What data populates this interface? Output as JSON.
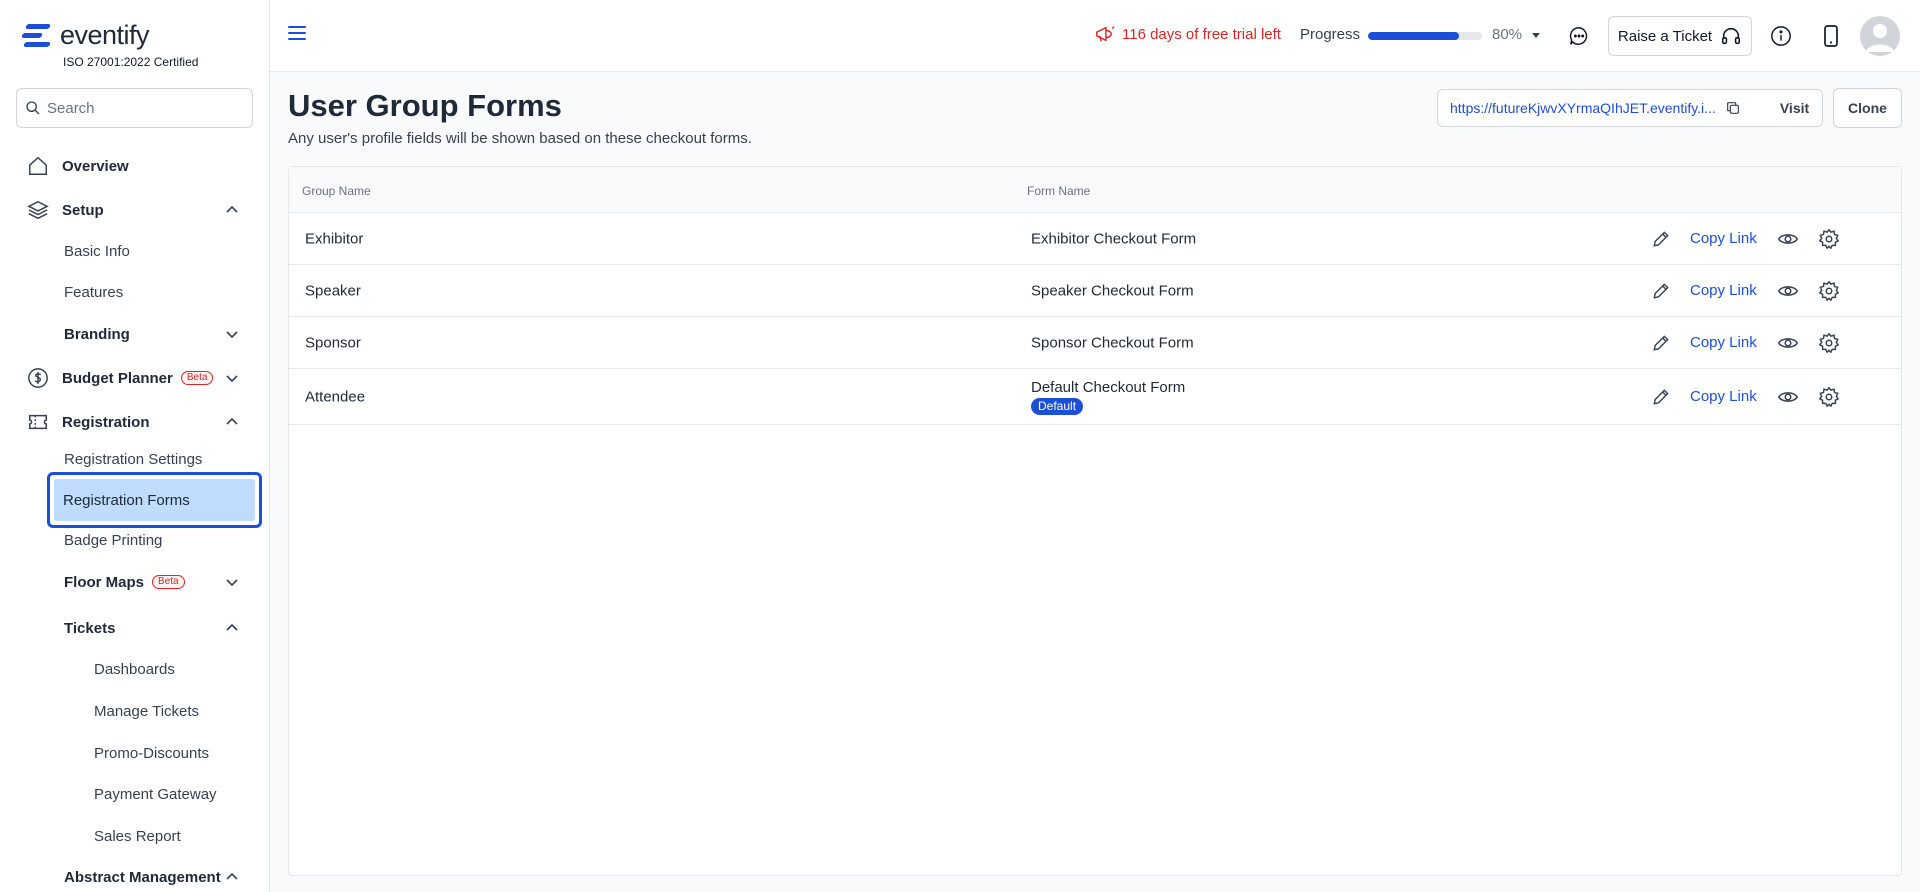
{
  "brand": {
    "name": "eventify",
    "certification": "ISO 27001:2022 Certified"
  },
  "search": {
    "placeholder": "Search",
    "value": ""
  },
  "sidebar": {
    "overview": "Overview",
    "setup": "Setup",
    "basic_info": "Basic Info",
    "features": "Features",
    "branding": "Branding",
    "budget_planner": "Budget Planner",
    "beta": "Beta",
    "registration": "Registration",
    "registration_settings": "Registration Settings",
    "registration_forms": "Registration Forms",
    "badge_printing": "Badge Printing",
    "floor_maps": "Floor Maps",
    "tickets": "Tickets",
    "dashboards": "Dashboards",
    "manage_tickets": "Manage Tickets",
    "promo_discounts": "Promo-Discounts",
    "payment_gateway": "Payment Gateway",
    "sales_report": "Sales Report",
    "abstract_management": "Abstract Management"
  },
  "header": {
    "trial_text": "116 days of free trial left",
    "progress_label": "Progress",
    "progress_value": "80%",
    "progress_fraction": 0.8,
    "raise_ticket": "Raise a Ticket"
  },
  "main": {
    "title": "User Group Forms",
    "subtitle": "Any user's profile fields will be shown based on these checkout forms.",
    "url": "https://futureKjwvXYrmaQIhJET.eventify.i...",
    "visit": "Visit",
    "clone": "Clone",
    "table": {
      "headers": [
        "Group Name",
        "Form Name"
      ],
      "rows": [
        {
          "group": "Exhibitor",
          "form": "Exhibitor Checkout Form",
          "badge": "",
          "action": "Copy Link"
        },
        {
          "group": "Speaker",
          "form": "Speaker Checkout Form",
          "badge": "",
          "action": "Copy Link"
        },
        {
          "group": "Sponsor",
          "form": "Sponsor Checkout Form",
          "badge": "",
          "action": "Copy Link"
        },
        {
          "group": "Attendee",
          "form": "Default Checkout Form",
          "badge": "Default",
          "action": "Copy Link"
        }
      ]
    }
  },
  "colors": {
    "accent": "#1d4ed8",
    "trial_red": "#dc2626",
    "active_bg": "#bfdbfe"
  }
}
